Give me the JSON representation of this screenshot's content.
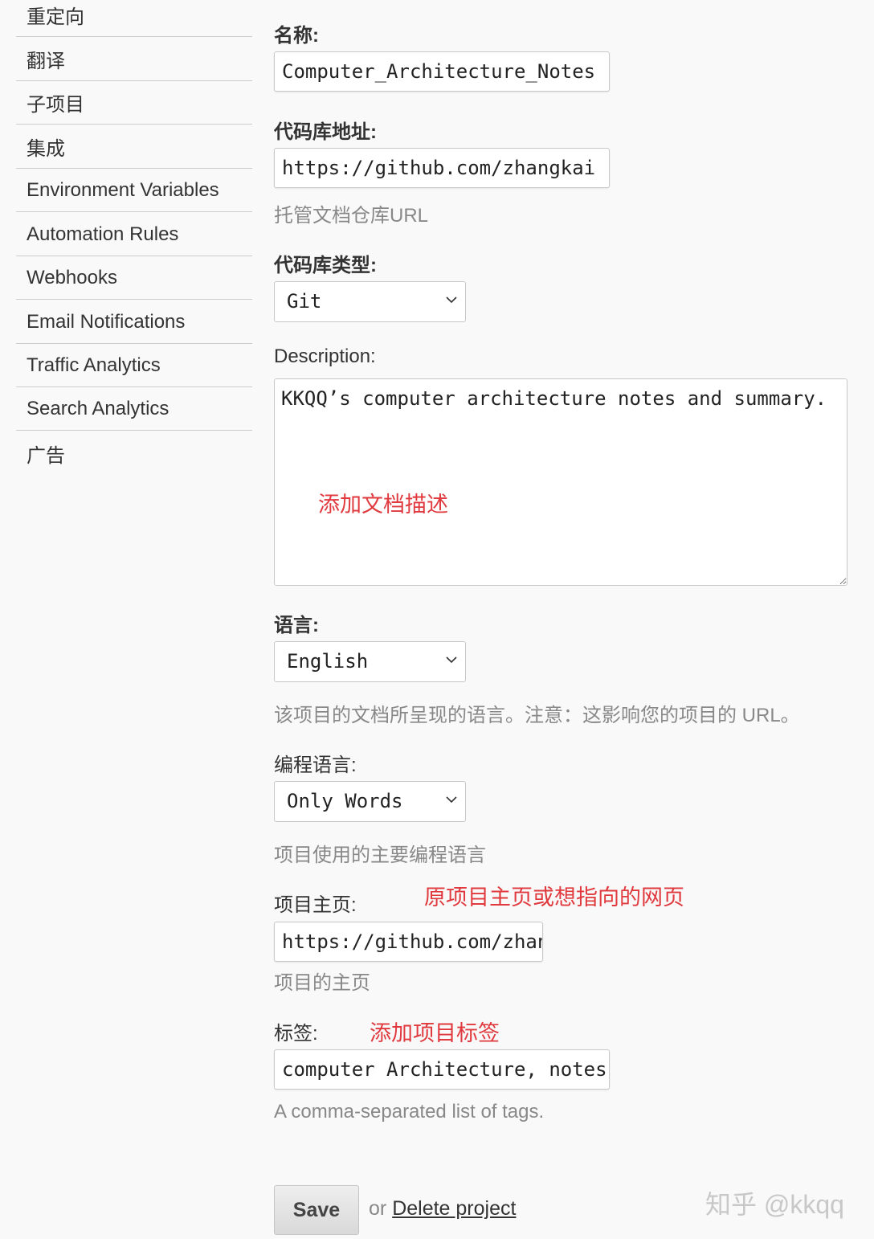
{
  "sidebar": {
    "items": [
      {
        "label": "重定向"
      },
      {
        "label": "翻译"
      },
      {
        "label": "子项目"
      },
      {
        "label": "集成"
      },
      {
        "label": "Environment Variables"
      },
      {
        "label": "Automation Rules"
      },
      {
        "label": "Webhooks"
      },
      {
        "label": "Email Notifications"
      },
      {
        "label": "Traffic Analytics"
      },
      {
        "label": "Search Analytics"
      },
      {
        "label": "广告"
      }
    ]
  },
  "form": {
    "name": {
      "label": "名称:",
      "value": "Computer_Architecture_Notes"
    },
    "repo_url": {
      "label": "代码库地址:",
      "value": "https://github.com/zhangkai",
      "help": "托管文档仓库URL"
    },
    "repo_type": {
      "label": "代码库类型:",
      "selected": "Git"
    },
    "description": {
      "label": "Description:",
      "value": "KKQQ’s computer architecture notes and summary.",
      "annotation": "添加文档描述"
    },
    "language": {
      "label": "语言:",
      "selected": "English",
      "help": "该项目的文档所呈现的语言。注意：这影响您的项目的 URL。"
    },
    "programming_language": {
      "label": "编程语言:",
      "selected": "Only Words",
      "help": "项目使用的主要编程语言"
    },
    "homepage": {
      "label": "项目主页:",
      "value": "https://github.com/zhangkai",
      "help": "项目的主页",
      "annotation": "原项目主页或想指向的网页"
    },
    "tags": {
      "label": "标签:",
      "value": "computer Architecture, notes",
      "help": "A comma-separated list of tags.",
      "annotation": "添加项目标签"
    },
    "save_label": "Save",
    "or_text": "or",
    "delete_label": "Delete project"
  },
  "watermark": "知乎 @kkqq",
  "colors": {
    "annotation": "#e0393e",
    "background": "#f9f9f9"
  }
}
